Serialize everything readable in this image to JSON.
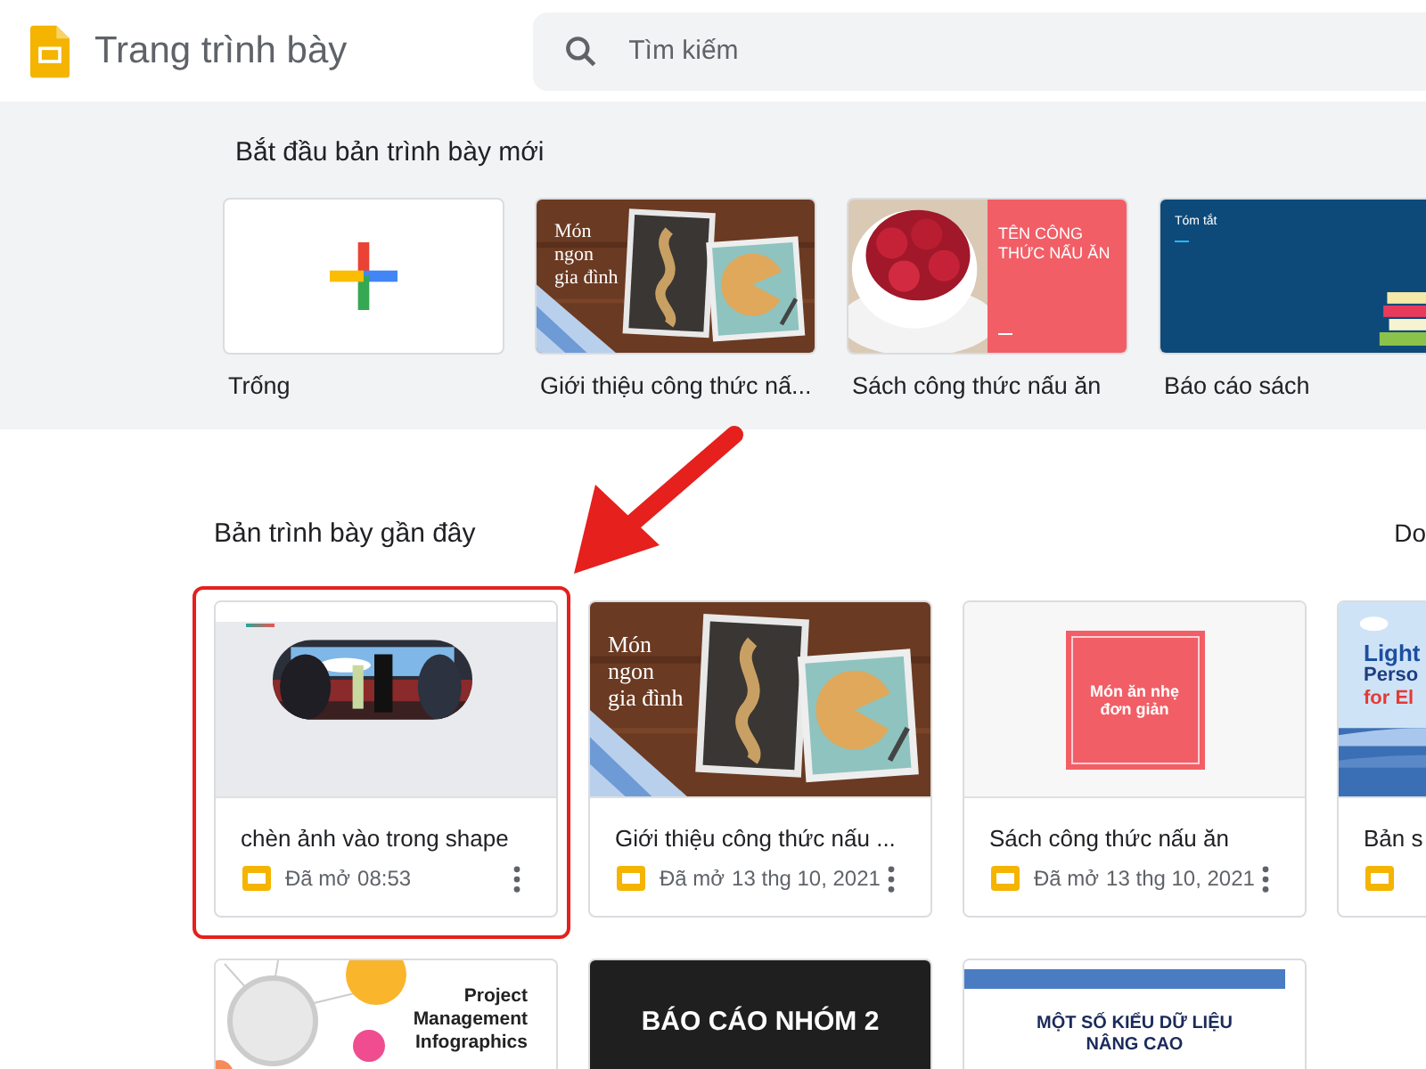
{
  "app": {
    "title": "Trang trình bày"
  },
  "search": {
    "placeholder": "Tìm kiếm"
  },
  "templates": {
    "heading": "Bắt đầu bản trình bày mới",
    "items": [
      {
        "kind": "blank",
        "label": "Trống"
      },
      {
        "kind": "recipe",
        "label": "Giới thiệu công thức nấ...",
        "slide_text": [
          "Món",
          "ngon",
          "gia đình"
        ]
      },
      {
        "kind": "cookbook",
        "label": "Sách công thức nấu ăn",
        "slide_text": [
          "TÊN CÔNG THỨC NẤU ĂN"
        ]
      },
      {
        "kind": "report",
        "label": "Báo cáo sách",
        "slide_text": [
          "Tóm tắt"
        ]
      }
    ]
  },
  "recent": {
    "heading": "Bản trình bày gần đây",
    "owner_filter": "Do",
    "files": [
      {
        "kind": "shape",
        "title": "chèn ảnh vào trong shape",
        "opened_label": "Đã mở",
        "opened_time": "08:53",
        "highlighted": true
      },
      {
        "kind": "recipe",
        "title": "Giới thiệu công thức nấu ...",
        "opened_label": "Đã mở",
        "opened_time": "13 thg 10, 2021",
        "highlighted": false,
        "slide_text": [
          "Món",
          "ngon",
          "gia đình"
        ]
      },
      {
        "kind": "snack",
        "title": "Sách công thức nấu ăn",
        "opened_label": "Đã mở",
        "opened_time": "13 thg 10, 2021",
        "highlighted": false,
        "slide_text": [
          "Món ăn nhẹ đơn giản"
        ]
      },
      {
        "kind": "lesson",
        "title": "Bản s",
        "highlighted": false,
        "slide_text": [
          "Light",
          "Perso",
          "for El"
        ]
      },
      {
        "kind": "infographic",
        "slide_text": [
          "Project Management Infographics"
        ]
      },
      {
        "kind": "chalkboard",
        "slide_text": [
          "BÁO CÁO NHÓM 2"
        ]
      },
      {
        "kind": "data",
        "slide_text": [
          "MỘT SỐ KIỂU DỮ LIỆU NÂNG CAO"
        ]
      }
    ]
  },
  "annotations": [
    {
      "kind": "arrow"
    }
  ]
}
